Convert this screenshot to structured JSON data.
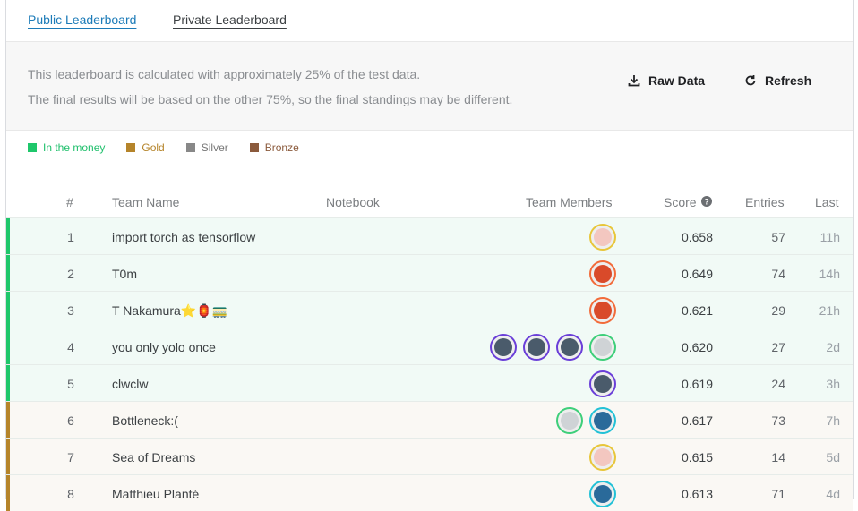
{
  "tabs": [
    {
      "label": "Public Leaderboard",
      "active": true
    },
    {
      "label": "Private Leaderboard",
      "active": false
    }
  ],
  "notice": {
    "line1": "This leaderboard is calculated with approximately 25% of the test data.",
    "line2": "The final results will be based on the other 75%, so the final standings may be different."
  },
  "actions": {
    "raw_data": "Raw Data",
    "refresh": "Refresh"
  },
  "legend": [
    {
      "label": "In the money",
      "color": "#20beff",
      "text_color": "#1ebf6b",
      "swatch": "#1fc76b"
    },
    {
      "label": "Gold",
      "color": "#b5842a",
      "text_color": "#b5842a",
      "swatch": "#b5842a"
    },
    {
      "label": "Silver",
      "color": "#888888",
      "text_color": "#777777",
      "swatch": "#888888"
    },
    {
      "label": "Bronze",
      "color": "#8b5a3c",
      "text_color": "#8b5a3c",
      "swatch": "#8b5a3c"
    }
  ],
  "columns": {
    "rank": "#",
    "team": "Team Name",
    "notebook": "Notebook",
    "members": "Team Members",
    "score": "Score",
    "entries": "Entries",
    "last": "Last"
  },
  "rows": [
    {
      "rank": "1",
      "team": "import torch as tensorflow",
      "score": "0.658",
      "entries": "57",
      "last": "11h",
      "tier": "money",
      "members": [
        "avatar-gold"
      ]
    },
    {
      "rank": "2",
      "team": "T0m",
      "score": "0.649",
      "entries": "74",
      "last": "14h",
      "tier": "money",
      "members": [
        "avatar-orange"
      ]
    },
    {
      "rank": "3",
      "team": "T Nakamura⭐🏮🚃",
      "score": "0.621",
      "entries": "29",
      "last": "21h",
      "tier": "money",
      "members": [
        "avatar-orange"
      ]
    },
    {
      "rank": "4",
      "team": "you only yolo once",
      "score": "0.620",
      "entries": "27",
      "last": "2d",
      "tier": "money",
      "members": [
        "avatar-purple",
        "avatar-purple",
        "avatar-purple",
        "avatar-green"
      ]
    },
    {
      "rank": "5",
      "team": "clwclw",
      "score": "0.619",
      "entries": "24",
      "last": "3h",
      "tier": "money",
      "members": [
        "avatar-purple"
      ]
    },
    {
      "rank": "6",
      "team": "Bottleneck:(",
      "score": "0.617",
      "entries": "73",
      "last": "7h",
      "tier": "gold",
      "members": [
        "avatar-green",
        "avatar-teal"
      ]
    },
    {
      "rank": "7",
      "team": "Sea of Dreams",
      "score": "0.615",
      "entries": "14",
      "last": "5d",
      "tier": "gold",
      "members": [
        "avatar-gold"
      ]
    },
    {
      "rank": "8",
      "team": "Matthieu Planté",
      "score": "0.613",
      "entries": "71",
      "last": "4d",
      "tier": "gold",
      "members": [
        "avatar-teal"
      ]
    }
  ],
  "colors": {
    "money_bar": "#1fc76b",
    "money_bg": "#f1faf6",
    "gold_bar": "#b5842a",
    "gold_bg": "#faf8f4",
    "tab_active": "#1c7bb8"
  }
}
